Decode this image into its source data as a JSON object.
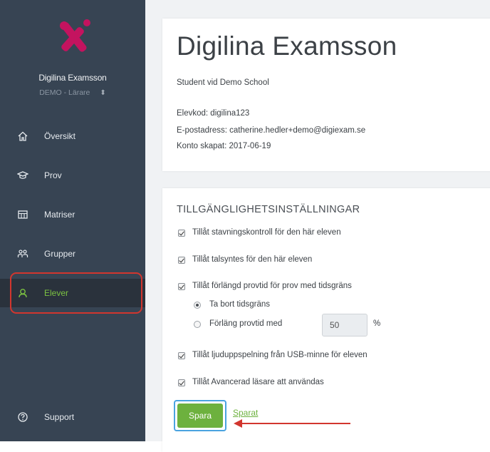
{
  "sidebar": {
    "user_name": "Digilina Examsson",
    "role": "DEMO - Lärare",
    "nav": [
      {
        "label": "Översikt",
        "icon": "home-icon"
      },
      {
        "label": "Prov",
        "icon": "graduation-cap-icon"
      },
      {
        "label": "Matriser",
        "icon": "table-icon"
      },
      {
        "label": "Grupper",
        "icon": "group-icon"
      },
      {
        "label": "Elever",
        "icon": "student-icon"
      }
    ],
    "support": {
      "label": "Support",
      "icon": "help-icon"
    }
  },
  "profile": {
    "name": "Digilina Examsson",
    "subtitle": "Student vid Demo School",
    "student_code": "Elevkod: digilina123",
    "email": "E-postadress: catherine.hedler+demo@digiexam.se",
    "created": "Konto skapat: 2017-06-19"
  },
  "accessibility": {
    "title": "TILLGÄNGLIGHETSINSTÄLLNINGAR",
    "spellcheck": "Tillåt stavningskontroll för den här eleven",
    "tts": "Tillåt talsyntes för den här eleven",
    "extended_time": "Tillåt förlängd provtid för prov med tidsgräns",
    "remove_limit": "Ta bort tidsgräns",
    "extend_by": "Förläng provtid med",
    "extend_value": "50",
    "percent": "%",
    "usb_audio": "Tillåt ljuduppspelning från USB-minne för eleven",
    "advanced_reader": "Tillåt Avancerad läsare att användas",
    "save_label": "Spara",
    "saved_label": "Sparat"
  },
  "colors": {
    "sidebar_bg": "#374453",
    "accent_green": "#6db13e",
    "logo_pink": "#c4135f",
    "highlight_red": "#d2362e"
  }
}
